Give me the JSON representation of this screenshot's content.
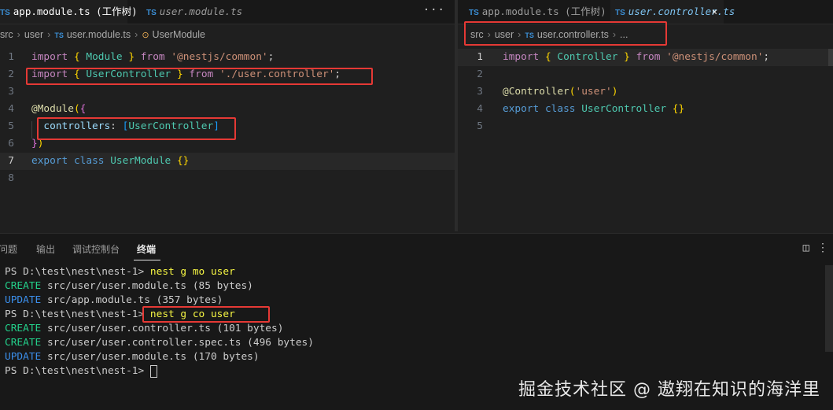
{
  "left_editor": {
    "tabs": [
      {
        "badge": "TS",
        "label": "app.module.ts (工作树)"
      },
      {
        "badge": "TS",
        "label": "user.module.ts"
      }
    ],
    "more_label": "···",
    "breadcrumb": [
      "src",
      "user",
      "user.module.ts",
      "UserModule"
    ],
    "breadcrumb_badge": "TS",
    "lines": [
      {
        "n": "1",
        "tokens": [
          [
            "kwc",
            "import"
          ],
          [
            "plain",
            " "
          ],
          [
            "br1",
            "{"
          ],
          [
            "plain",
            " "
          ],
          [
            "ty",
            "Module"
          ],
          [
            "plain",
            " "
          ],
          [
            "br1",
            "}"
          ],
          [
            "plain",
            " "
          ],
          [
            "kwc",
            "from"
          ],
          [
            "plain",
            " "
          ],
          [
            "str",
            "'@nestjs/common'"
          ],
          [
            "plain",
            ";"
          ]
        ]
      },
      {
        "n": "2",
        "tokens": [
          [
            "kwc",
            "import"
          ],
          [
            "plain",
            " "
          ],
          [
            "br1",
            "{"
          ],
          [
            "plain",
            " "
          ],
          [
            "ty",
            "UserController"
          ],
          [
            "plain",
            " "
          ],
          [
            "br1",
            "}"
          ],
          [
            "plain",
            " "
          ],
          [
            "kwc",
            "from"
          ],
          [
            "plain",
            " "
          ],
          [
            "str",
            "'./user.controller'"
          ],
          [
            "plain",
            ";"
          ]
        ]
      },
      {
        "n": "3",
        "tokens": []
      },
      {
        "n": "4",
        "tokens": [
          [
            "dec",
            "@"
          ],
          [
            "dec",
            "Module"
          ],
          [
            "br1",
            "("
          ],
          [
            "br2",
            "{"
          ]
        ]
      },
      {
        "n": "5",
        "tokens": [
          [
            "plain",
            "  "
          ],
          [
            "id",
            "controllers"
          ],
          [
            "plain",
            ": "
          ],
          [
            "br3",
            "["
          ],
          [
            "ty",
            "UserController"
          ],
          [
            "br3",
            "]"
          ]
        ]
      },
      {
        "n": "6",
        "tokens": [
          [
            "br2",
            "}"
          ],
          [
            "br1",
            ")"
          ]
        ]
      },
      {
        "n": "7",
        "tokens": [
          [
            "kw",
            "export"
          ],
          [
            "plain",
            " "
          ],
          [
            "kw",
            "class"
          ],
          [
            "plain",
            " "
          ],
          [
            "ty",
            "UserModule"
          ],
          [
            "plain",
            " "
          ],
          [
            "br1",
            "{}"
          ]
        ]
      },
      {
        "n": "8",
        "tokens": []
      }
    ]
  },
  "right_editor": {
    "tabs": [
      {
        "badge": "TS",
        "label": "app.module.ts (工作树)"
      },
      {
        "badge": "TS",
        "label": "user.controller.ts"
      }
    ],
    "close_label": "×",
    "breadcrumb": [
      "src",
      "user",
      "user.controller.ts",
      "..."
    ],
    "breadcrumb_badge": "TS",
    "lines": [
      {
        "n": "1",
        "tokens": [
          [
            "kwc",
            "import"
          ],
          [
            "plain",
            " "
          ],
          [
            "br1",
            "{"
          ],
          [
            "plain",
            " "
          ],
          [
            "ty",
            "Controller"
          ],
          [
            "plain",
            " "
          ],
          [
            "br1",
            "}"
          ],
          [
            "plain",
            " "
          ],
          [
            "kwc",
            "from"
          ],
          [
            "plain",
            " "
          ],
          [
            "str",
            "'@nestjs/common'"
          ],
          [
            "plain",
            ";"
          ]
        ]
      },
      {
        "n": "2",
        "tokens": []
      },
      {
        "n": "3",
        "tokens": [
          [
            "dec",
            "@"
          ],
          [
            "dec",
            "Controller"
          ],
          [
            "br1",
            "("
          ],
          [
            "str",
            "'user'"
          ],
          [
            "br1",
            ")"
          ]
        ]
      },
      {
        "n": "4",
        "tokens": [
          [
            "kw",
            "export"
          ],
          [
            "plain",
            " "
          ],
          [
            "kw",
            "class"
          ],
          [
            "plain",
            " "
          ],
          [
            "ty",
            "UserController"
          ],
          [
            "plain",
            " "
          ],
          [
            "br1",
            "{}"
          ]
        ]
      },
      {
        "n": "5",
        "tokens": []
      }
    ]
  },
  "panel": {
    "tabs": [
      "问题",
      "输出",
      "调试控制台",
      "终端"
    ],
    "active_tab": "终端",
    "split_icon": "split-icon",
    "terminal_lines": [
      [
        [
          "plain",
          "PS D:\\test\\nest\\nest-1> "
        ],
        [
          "cmd",
          "nest g mo user"
        ]
      ],
      [
        [
          "create",
          "CREATE"
        ],
        [
          "plain",
          " src/user/user.module.ts (85 bytes)"
        ]
      ],
      [
        [
          "update",
          "UPDATE"
        ],
        [
          "plain",
          " src/app.module.ts (357 bytes)"
        ]
      ],
      [
        [
          "plain",
          "PS D:\\test\\nest\\nest-1> "
        ],
        [
          "cmd",
          "nest g co user"
        ]
      ],
      [
        [
          "create",
          "CREATE"
        ],
        [
          "plain",
          " src/user/user.controller.ts (101 bytes)"
        ]
      ],
      [
        [
          "create",
          "CREATE"
        ],
        [
          "plain",
          " src/user/user.controller.spec.ts (496 bytes)"
        ]
      ],
      [
        [
          "update",
          "UPDATE"
        ],
        [
          "plain",
          " src/user/user.module.ts (170 bytes)"
        ]
      ],
      [
        [
          "plain",
          "PS D:\\test\\nest\\nest-1> "
        ]
      ]
    ]
  },
  "watermark": "掘金技术社区 @ 遨翔在知识的海洋里",
  "colors": {
    "annotation_box": "#e53935",
    "ts_badge": "#3b8fd6"
  }
}
